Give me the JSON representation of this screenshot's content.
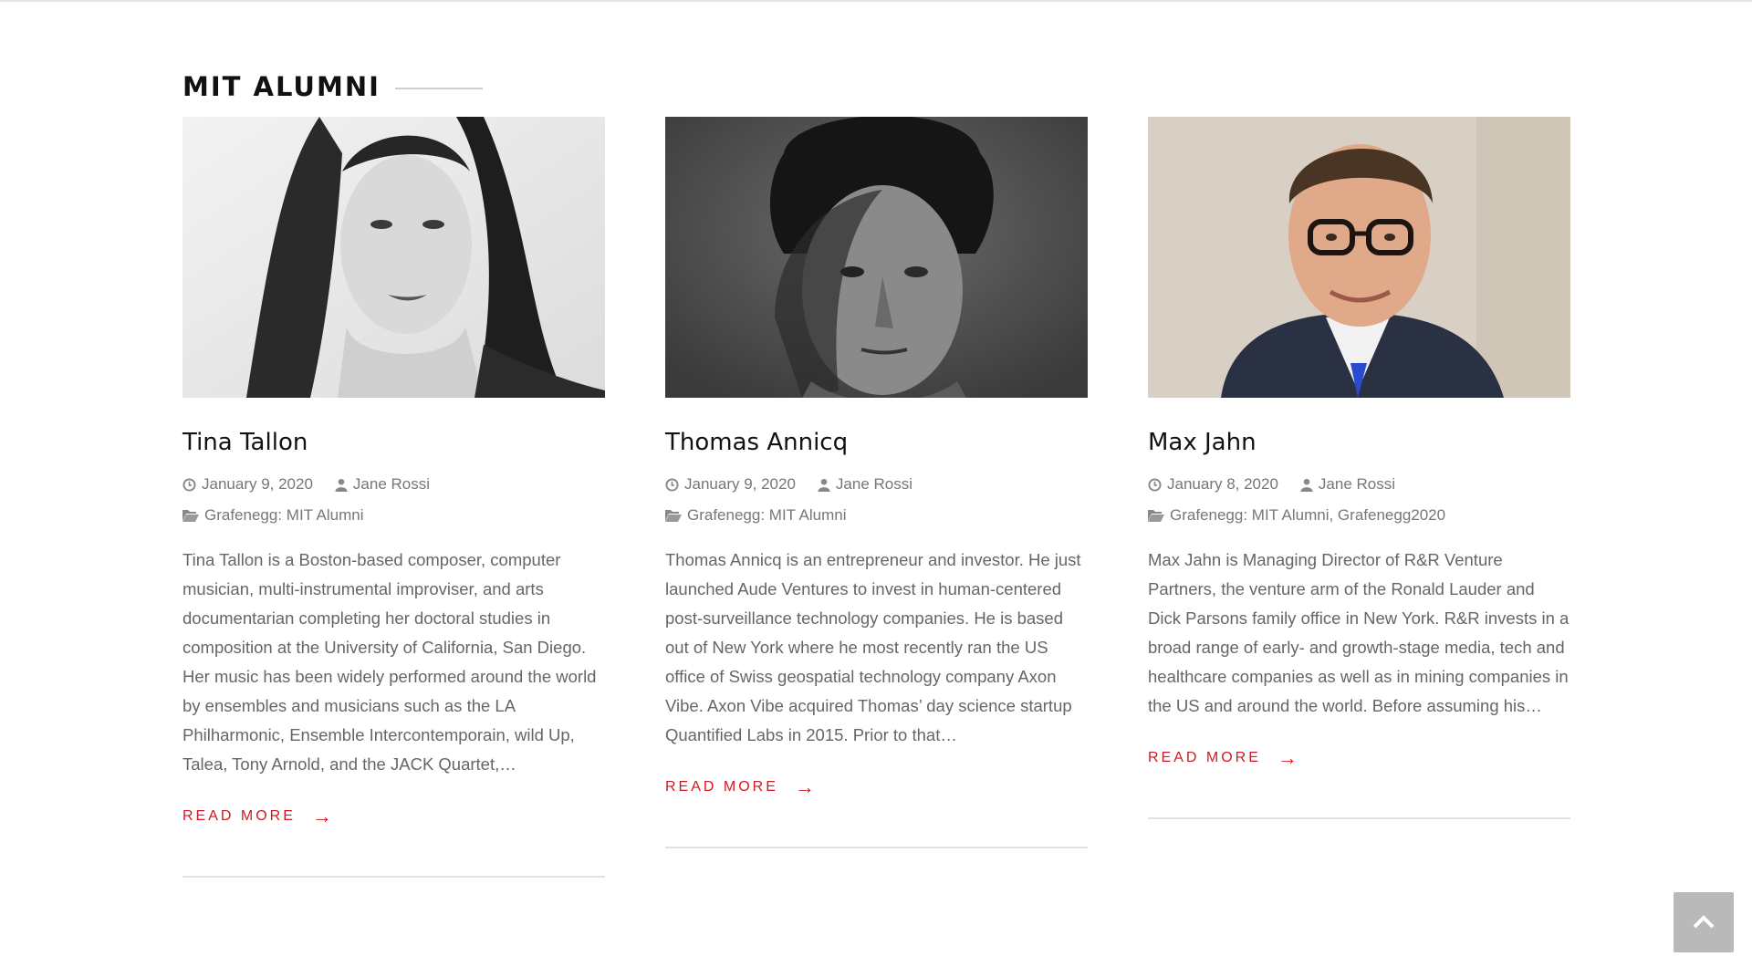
{
  "section": {
    "title": "MIT ALUMNI"
  },
  "cards": [
    {
      "name": "Tina Tallon",
      "date": "January 9, 2020",
      "author": "Jane Rossi",
      "categories": "Grafenegg: MIT Alumni",
      "excerpt": "Tina Tallon is a Boston-based composer, computer musician, multi-instrumental improviser, and arts documentarian completing her doctoral studies in composition at the University of California, San Diego. Her music has been widely performed around the world by ensembles and musicians such as the LA Philharmonic, Ensemble Intercontemporain, wild Up, Talea, Tony Arnold, and the JACK Quartet,…",
      "read_more": "READ MORE",
      "photo": "portrait-black-and-white-woman"
    },
    {
      "name": "Thomas Annicq",
      "date": "January 9, 2020",
      "author": "Jane Rossi",
      "categories": "Grafenegg: MIT Alumni",
      "excerpt": "Thomas Annicq is an entrepreneur and investor. He just launched Aude Ventures to invest in human-centered post-surveillance technology companies. He is based out of New York where he most recently ran the US office of Swiss geospatial technology company Axon Vibe. Axon Vibe acquired Thomas’ day science startup Quantified Labs in 2015. Prior to that…",
      "read_more": "READ MORE",
      "photo": "portrait-black-and-white-man"
    },
    {
      "name": "Max Jahn",
      "date": "January 8, 2020",
      "author": "Jane Rossi",
      "categories": "Grafenegg: MIT Alumni, Grafenegg2020",
      "excerpt": " Max Jahn is Managing Director of R&R Venture Partners, the venture arm of the Ronald Lauder and Dick Parsons family office in New York. R&R invests in a broad range of early- and growth-stage media, tech and healthcare companies as well as in mining companies in the US and around the world. Before assuming his…",
      "read_more": "READ MORE",
      "photo": "portrait-color-man-glasses-suit"
    }
  ],
  "icons": {
    "date": "clock-icon",
    "author": "user-icon",
    "category": "folder-open-icon",
    "arrow": "arrow-right-icon",
    "back_to_top": "chevron-up-icon"
  },
  "colors": {
    "accent": "#d0191f",
    "meta": "#777777",
    "back_to_top": "#b9b9b9"
  }
}
